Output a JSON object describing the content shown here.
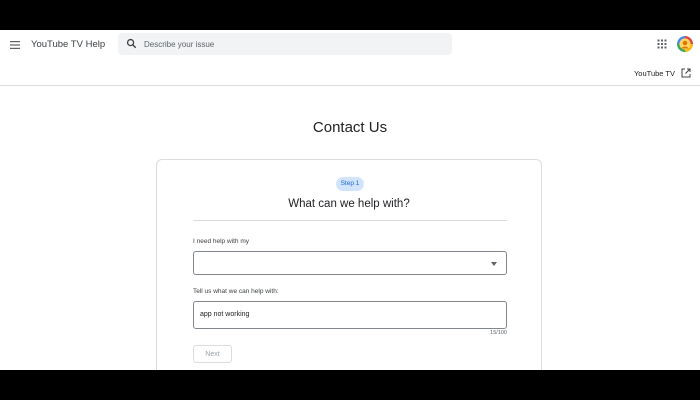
{
  "header": {
    "app_name": "YouTube TV Help",
    "search_placeholder": "Describe your issue",
    "menu_icon": "hamburger-menu-icon",
    "apps_icon": "google-apps-grid-icon",
    "avatar_icon": "account-avatar"
  },
  "subheader": {
    "product_link_label": "YouTube TV",
    "product_link_icon": "open-in-new-icon"
  },
  "page": {
    "title": "Contact Us"
  },
  "form": {
    "step_badge": "Step 1",
    "step_title": "What can we help with?",
    "topic_label": "I need help with my",
    "topic_value": "",
    "details_label": "Tell us what we can help with:",
    "details_value": "app not working",
    "char_counter": "15/100",
    "next_label": "Next"
  },
  "colors": {
    "accent_blue": "#1967d2",
    "badge_bg": "#d2e3fc",
    "border": "#dadce0",
    "search_bg": "#f1f3f4"
  }
}
